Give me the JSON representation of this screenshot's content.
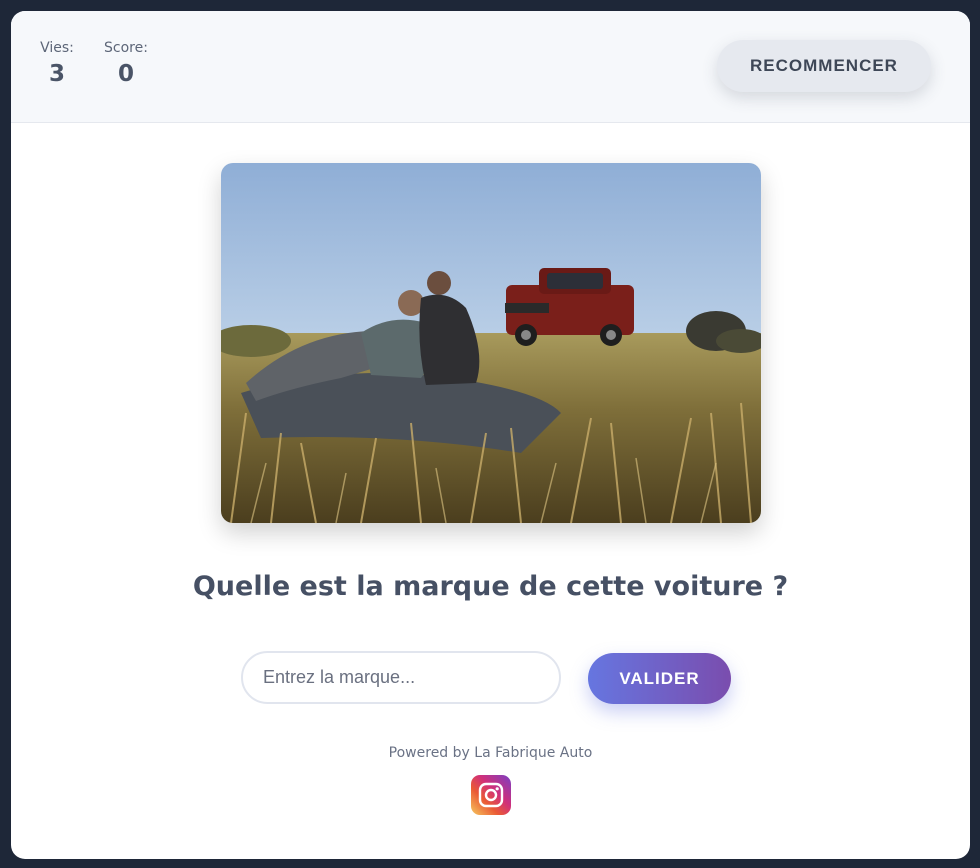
{
  "stats": {
    "lives_label": "Vies:",
    "lives_value": "3",
    "score_label": "Score:",
    "score_value": "0"
  },
  "header": {
    "restart_label": "RECOMMENCER"
  },
  "quiz": {
    "question": "Quelle est la marque de cette voiture ?",
    "answer_placeholder": "Entrez la marque...",
    "submit_label": "VALIDER"
  },
  "footer": {
    "powered_by": "Powered by La Fabrique Auto",
    "social_icon": "instagram-icon"
  },
  "colors": {
    "background": "#1e2738",
    "header_bg": "#f6f8fb",
    "button_gradient_start": "#6676e0",
    "button_gradient_end": "#7a4dae",
    "text_dark": "#465064"
  }
}
